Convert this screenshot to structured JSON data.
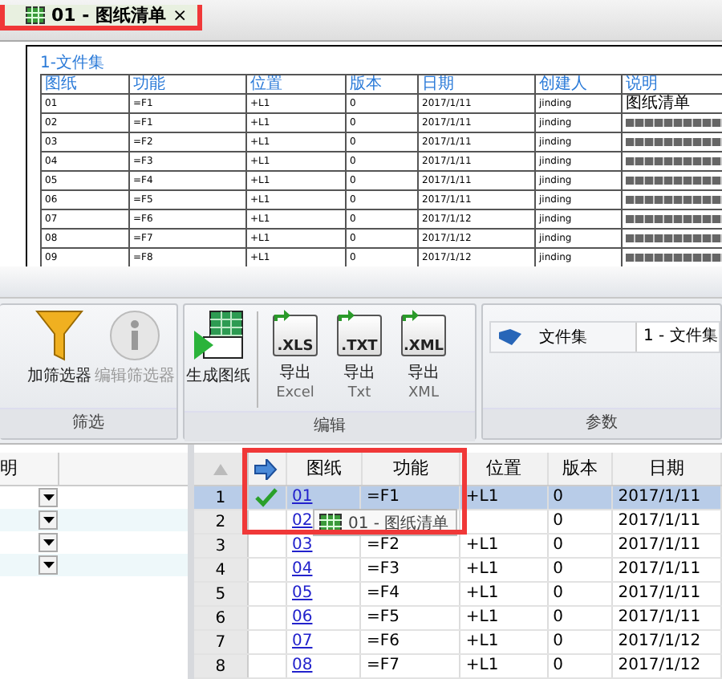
{
  "document_tab": {
    "label": "01 - 图纸清单",
    "close": "×"
  },
  "preview": {
    "title": "1-文件集",
    "columns": [
      "图纸",
      "功能",
      "位置",
      "版本",
      "日期",
      "创建人",
      "说明"
    ],
    "rows": [
      {
        "cells": [
          "01",
          "=F1",
          "+L1",
          "0",
          "2017/1/11",
          "jinding",
          "图纸清单"
        ]
      },
      {
        "cells": [
          "02",
          "=F1",
          "+L1",
          "0",
          "2017/1/11",
          "jinding"
        ]
      },
      {
        "cells": [
          "03",
          "=F2",
          "+L1",
          "0",
          "2017/1/11",
          "jinding"
        ]
      },
      {
        "cells": [
          "04",
          "=F3",
          "+L1",
          "0",
          "2017/1/11",
          "jinding"
        ]
      },
      {
        "cells": [
          "05",
          "=F4",
          "+L1",
          "0",
          "2017/1/11",
          "jinding"
        ]
      },
      {
        "cells": [
          "06",
          "=F5",
          "+L1",
          "0",
          "2017/1/11",
          "jinding"
        ]
      },
      {
        "cells": [
          "07",
          "=F6",
          "+L1",
          "0",
          "2017/1/12",
          "jinding"
        ]
      },
      {
        "cells": [
          "08",
          "=F7",
          "+L1",
          "0",
          "2017/1/12",
          "jinding"
        ]
      },
      {
        "cells": [
          "09",
          "=F8",
          "+L1",
          "0",
          "2017/1/12",
          "jinding"
        ]
      }
    ]
  },
  "ribbon": {
    "groups": [
      {
        "label": "筛选",
        "buttons": [
          {
            "kind": "funnel",
            "label": "加筛选器",
            "disabled": false
          },
          {
            "kind": "info",
            "label": "编辑筛选器",
            "disabled": true
          }
        ]
      },
      {
        "label": "编辑",
        "buttons": [
          {
            "kind": "grid",
            "label": "生成图纸"
          },
          {
            "kind": "export",
            "badge": ".XLS",
            "label": "导出",
            "sublabel": "Excel"
          },
          {
            "kind": "export",
            "badge": ".TXT",
            "label": "导出",
            "sublabel": "Txt"
          },
          {
            "kind": "export",
            "badge": ".XML",
            "label": "导出",
            "sublabel": "XML"
          }
        ]
      },
      {
        "label": "参数",
        "field": {
          "label": "文件集",
          "value": "1 - 文件集"
        }
      }
    ]
  },
  "left_panel": {
    "column": "明"
  },
  "grid": {
    "columns": [
      "图纸",
      "功能",
      "位置",
      "版本",
      "日期"
    ],
    "rows": [
      {
        "num": "1",
        "selected": true,
        "checked": true,
        "cells": [
          "01",
          "=F1",
          "+L1",
          "0",
          "2017/1/11"
        ]
      },
      {
        "num": "2",
        "selected": false,
        "checked": false,
        "cells": [
          "02",
          null,
          null,
          "0",
          "2017/1/11"
        ]
      },
      {
        "num": "3",
        "selected": false,
        "checked": false,
        "cells": [
          "03",
          "=F2",
          "+L1",
          "0",
          "2017/1/11"
        ]
      },
      {
        "num": "4",
        "selected": false,
        "checked": false,
        "cells": [
          "04",
          "=F3",
          "+L1",
          "0",
          "2017/1/11"
        ]
      },
      {
        "num": "5",
        "selected": false,
        "checked": false,
        "cells": [
          "05",
          "=F4",
          "+L1",
          "0",
          "2017/1/11"
        ]
      },
      {
        "num": "6",
        "selected": false,
        "checked": false,
        "cells": [
          "06",
          "=F5",
          "+L1",
          "0",
          "2017/1/11"
        ]
      },
      {
        "num": "7",
        "selected": false,
        "checked": false,
        "cells": [
          "07",
          "=F6",
          "+L1",
          "0",
          "2017/1/12"
        ]
      },
      {
        "num": "8",
        "selected": false,
        "checked": false,
        "cells": [
          "08",
          "=F7",
          "+L1",
          "0",
          "2017/1/12"
        ]
      }
    ]
  },
  "tooltip": {
    "label": "01 - 图纸清单"
  }
}
